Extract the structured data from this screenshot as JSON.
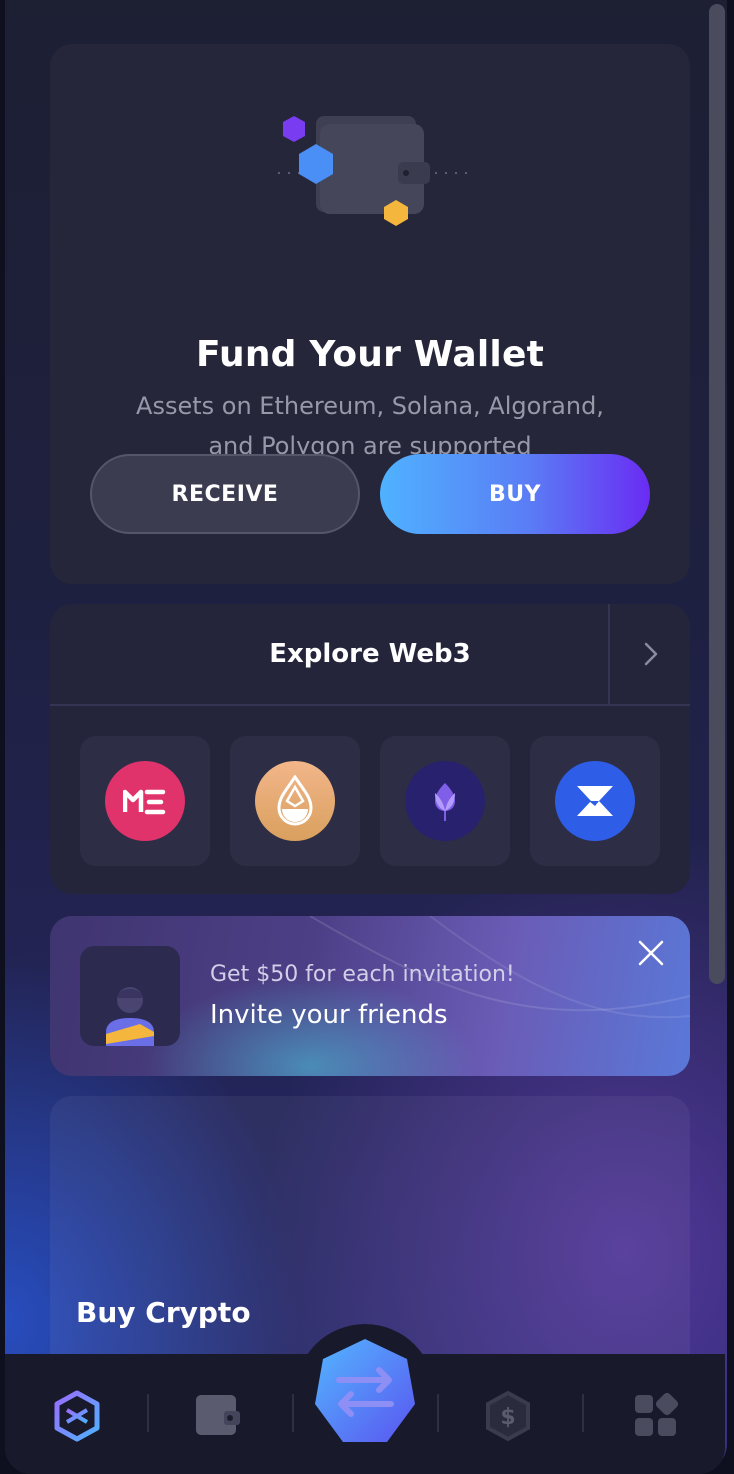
{
  "fund": {
    "title": "Fund Your Wallet",
    "subtitle_line1": "Assets on Ethereum, Solana, Algorand,",
    "subtitle_line2": "and Polygon are supported",
    "receive_label": "RECEIVE",
    "buy_label": "BUY"
  },
  "explore": {
    "title": "Explore Web3",
    "apps": [
      {
        "name": "magic-eden",
        "icon": "magic-eden-logo",
        "color": "#e0336b"
      },
      {
        "name": "drop",
        "icon": "drop-logo",
        "color": "#e8a47c"
      },
      {
        "name": "tulip",
        "icon": "tulip-logo",
        "color": "#27216e"
      },
      {
        "name": "zeta",
        "icon": "zeta-logo",
        "color": "#2e5ee8"
      }
    ]
  },
  "invite": {
    "line1": "Get $50 for each invitation!",
    "line2": "Invite your friends"
  },
  "buycrypto": {
    "title": "Buy Crypto"
  },
  "tabbar": {
    "items": [
      "logo-icon",
      "wallet-icon",
      "swap-icon",
      "dollar-hex-icon",
      "apps-grid-icon"
    ]
  },
  "colors": {
    "accent_blue": "#4fb2ff",
    "accent_purple": "#6a2cf3",
    "card_bg": "#25263a"
  }
}
